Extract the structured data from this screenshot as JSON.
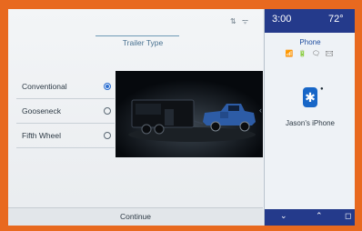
{
  "status": {
    "icons": "⇅ ᯤ"
  },
  "main": {
    "title": "Trailer Type",
    "options": [
      {
        "label": "Conventional",
        "selected": true
      },
      {
        "label": "Gooseneck",
        "selected": false
      },
      {
        "label": "Fifth Wheel",
        "selected": false
      }
    ],
    "continue": "Continue"
  },
  "sidebar": {
    "time": "3:00",
    "temp": "72°",
    "phone_title": "Phone",
    "phone_status_icons": "📶 🔋 🗨 ✉",
    "device": "Jason's iPhone",
    "nav_icons": [
      "⌄",
      "⌃",
      "◻"
    ]
  },
  "colors": {
    "accent": "#2d6fd0",
    "side_bar": "#243a8b",
    "bezel": "#e8691f"
  }
}
